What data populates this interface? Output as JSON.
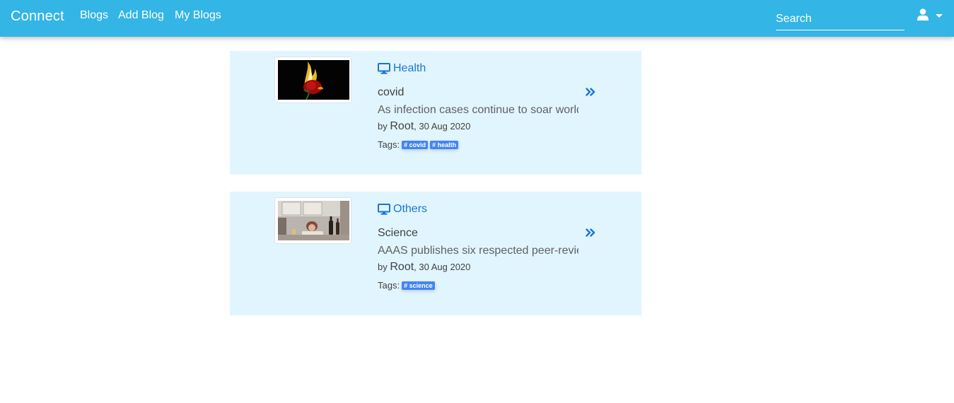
{
  "navbar": {
    "brand": "Connect",
    "links": [
      "Blogs",
      "Add Blog",
      "My Blogs"
    ],
    "search": {
      "placeholder": "Search",
      "value": ""
    },
    "user_icon": "user-icon",
    "dropdown_icon": "caret-down-icon"
  },
  "colors": {
    "navbar_bg": "#33b5e5",
    "card_bg": "#e1f5fe",
    "category_blue": "#1976d2",
    "tag_bg": "#4285f4"
  },
  "blogs": [
    {
      "category": "Health",
      "category_icon": "desktop-icon",
      "title": "covid",
      "excerpt": "As infection cases continue to soar worldwide",
      "by_label": "by",
      "author": "Root",
      "date": ", 30 Aug 2020",
      "tags_label": "Tags:",
      "tags": [
        "# covid",
        "# health"
      ],
      "thumbnail": "rose on fire image",
      "action_icon": "double-chevron-right-icon"
    },
    {
      "category": "Others",
      "category_icon": "desktop-icon",
      "title": "Science",
      "excerpt": "AAAS publishes six respected peer-reviewed journals",
      "by_label": "by",
      "author": "Root",
      "date": ", 30 Aug 2020",
      "tags_label": "Tags:",
      "tags": [
        "# science"
      ],
      "thumbnail": "woman at kitchen table image",
      "action_icon": "double-chevron-right-icon"
    }
  ]
}
